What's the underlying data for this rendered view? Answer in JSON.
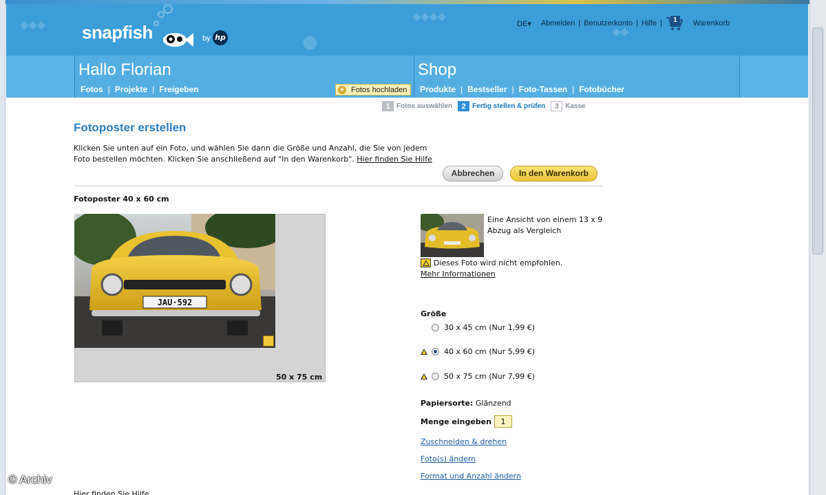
{
  "header": {
    "logo_text": "snapfish",
    "logo_by": "by",
    "hp_text": "hp",
    "lang": "DE▾",
    "links": [
      "Abmelden",
      "Benutzerkonto",
      "Hilfe"
    ],
    "cart_count": "1",
    "cart_label": "Warenkorb"
  },
  "nav": {
    "left_title": "Hallo Florian",
    "left_links": [
      "Fotos",
      "Projekte",
      "Freigeben"
    ],
    "upload_label": "Fotos hochladen",
    "right_title": "Shop",
    "right_links": [
      "Produkte",
      "Bestseller",
      "Foto-Tassen",
      "Fotobücher"
    ]
  },
  "steps": [
    {
      "num": "1",
      "label": "Fotos auswählen",
      "state": "done"
    },
    {
      "num": "2",
      "label": "Fertig stellen & prüfen",
      "state": "active"
    },
    {
      "num": "3",
      "label": "Kasse",
      "state": "todo"
    }
  ],
  "main": {
    "title": "Fotoposter erstellen",
    "intro_line1": "Klicken Sie unten auf ein Foto, und wählen Sie dann die Größe und Anzahl, die Sie von jedem",
    "intro_line2": "Foto bestellen möchten. Klicken Sie anschließend auf \"In den Warenkorb\".",
    "intro_help_link": "Hier finden Sie Hilfe",
    "cancel_button": "Abbrechen",
    "cart_button": "In den Warenkorb",
    "section_title": "Fotoposter 40 x 60 cm",
    "preview_size_label": "50 x 75 cm",
    "plate_text": "JAU·592",
    "thumb_note": "Eine Ansicht von einem 13 x 9 Abzug als Vergleich",
    "warning_text": "Dieses Foto wird nicht empfohlen.",
    "more_info": "Mehr Informationen",
    "size_heading": "Größe",
    "size_options": [
      {
        "label": "30 x 45 cm (Nur 1,99 €)",
        "warning": false,
        "selected": false
      },
      {
        "label": "40 x 60 cm (Nur 5,99 €)",
        "warning": true,
        "selected": true
      },
      {
        "label": "50 x 75 cm (Nur 7,99 €)",
        "warning": true,
        "selected": false
      }
    ],
    "paper_label": "Papiersorte:",
    "paper_value": "Glänzend",
    "qty_label": "Menge eingeben",
    "qty_value": "1",
    "links": [
      "Zuschneiden & drehen",
      "Foto(s) ändern",
      "Format und Anzahl ändern"
    ],
    "bottom_help": "Hier finden Sie Hilfe"
  },
  "watermark": "© Archiv",
  "colors": {
    "header_blue": "#3b9ed9",
    "title_blue": "#2b7fc0",
    "cart_button_yellow": "#f2d12a"
  }
}
